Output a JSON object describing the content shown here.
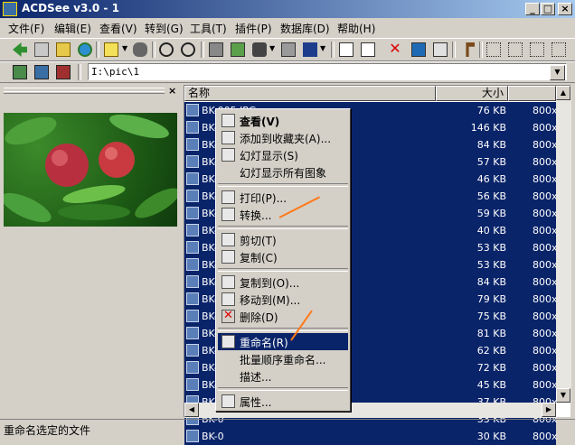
{
  "window": {
    "title": "ACDSee v3.0 - 1",
    "buttons": [
      "_",
      "□",
      "×"
    ]
  },
  "menubar": [
    {
      "label": "文件(F)"
    },
    {
      "label": "编辑(E)"
    },
    {
      "label": "查看(V)"
    },
    {
      "label": "转到(G)"
    },
    {
      "label": "工具(T)"
    },
    {
      "label": "插件(P)"
    },
    {
      "label": "数据库(D)"
    },
    {
      "label": "帮助(H)"
    }
  ],
  "address": {
    "path": "I:\\pic\\1"
  },
  "panel": {
    "close": "×"
  },
  "list": {
    "columns": {
      "name": "名称",
      "size": "大小"
    },
    "rows": [
      {
        "name": "BK-005.JPG",
        "size": "76 KB",
        "dim": "800x"
      },
      {
        "name": "BK-0",
        "size": "146 KB",
        "dim": "800x"
      },
      {
        "name": "BK-0",
        "size": "84 KB",
        "dim": "800x"
      },
      {
        "name": "BK-0",
        "size": "57 KB",
        "dim": "800x"
      },
      {
        "name": "BK-0",
        "size": "46 KB",
        "dim": "800x"
      },
      {
        "name": "BK-0",
        "size": "56 KB",
        "dim": "800x"
      },
      {
        "name": "BK-0",
        "size": "59 KB",
        "dim": "800x"
      },
      {
        "name": "BK-0",
        "size": "40 KB",
        "dim": "800x"
      },
      {
        "name": "BK-0",
        "size": "53 KB",
        "dim": "800x"
      },
      {
        "name": "BK-0",
        "size": "53 KB",
        "dim": "800x"
      },
      {
        "name": "BK-0",
        "size": "84 KB",
        "dim": "800x"
      },
      {
        "name": "BK-0",
        "size": "79 KB",
        "dim": "800x"
      },
      {
        "name": "BK-0",
        "size": "75 KB",
        "dim": "800x"
      },
      {
        "name": "BK-0",
        "size": "81 KB",
        "dim": "800x"
      },
      {
        "name": "BK-0",
        "size": "62 KB",
        "dim": "800x"
      },
      {
        "name": "BK-0",
        "size": "72 KB",
        "dim": "800x"
      },
      {
        "name": "BK-0",
        "size": "45 KB",
        "dim": "800x"
      },
      {
        "name": "BK-0",
        "size": "37 KB",
        "dim": "800x"
      },
      {
        "name": "BK-0",
        "size": "33 KB",
        "dim": "800x"
      },
      {
        "name": "BK-0",
        "size": "30 KB",
        "dim": "800x"
      }
    ]
  },
  "context_menu": {
    "items": [
      {
        "label": "查看(V)",
        "icon": "view-eyes-icon"
      },
      {
        "label": "添加到收藏夹(A)...",
        "icon": "favorites-add-icon"
      },
      {
        "label": "幻灯显示(S)",
        "icon": "slideshow-icon"
      },
      {
        "label": "幻灯显示所有图象",
        "icon": ""
      },
      {
        "label": "打印(P)...",
        "icon": "print-icon"
      },
      {
        "label": "转换...",
        "icon": "convert-icon"
      },
      {
        "label": "剪切(T)",
        "icon": "scissors-icon"
      },
      {
        "label": "复制(C)",
        "icon": "copy-icon"
      },
      {
        "label": "复制到(O)...",
        "icon": "copy-to-icon"
      },
      {
        "label": "移动到(M)...",
        "icon": "move-to-icon"
      },
      {
        "label": "删除(D)",
        "icon": "delete-x-icon"
      },
      {
        "label": "重命名(R)",
        "icon": "rename-icon"
      },
      {
        "label": "批量顺序重命名...",
        "icon": ""
      },
      {
        "label": "描述...",
        "icon": ""
      },
      {
        "label": "属性...",
        "icon": "properties-icon"
      }
    ]
  },
  "status": {
    "text": "重命名选定的文件"
  },
  "colors": {
    "selection": "#0a246a",
    "annotation_arrow": "#ff7a1a"
  }
}
